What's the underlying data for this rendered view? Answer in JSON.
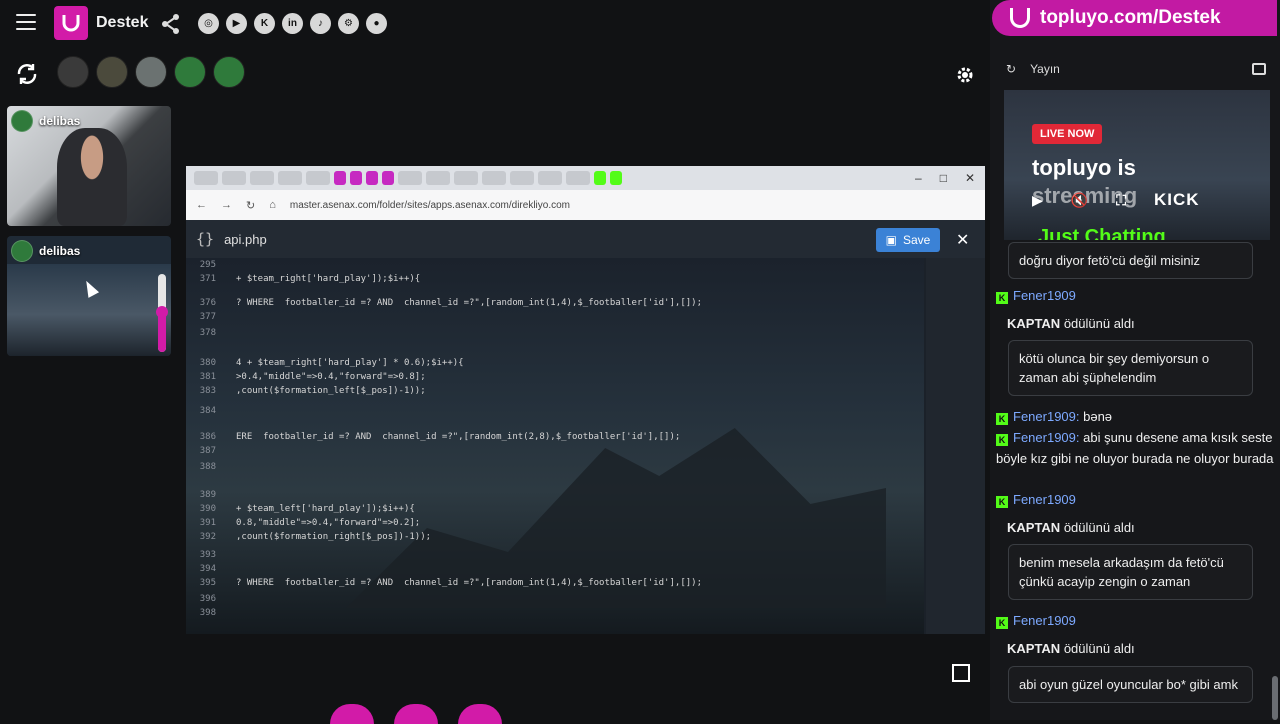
{
  "header": {
    "brand": "Destek",
    "socials": [
      "instagram-icon",
      "youtube-icon",
      "kick-icon",
      "linkedin-icon",
      "tiktok-icon",
      "steam-icon",
      "github-icon"
    ]
  },
  "cams": [
    {
      "name": "delibas"
    },
    {
      "name": "delibas"
    }
  ],
  "screen": {
    "url": "master.asenax.com/folder/sites/apps.asenax.com/direkliyo.com",
    "editor_title": "api.php",
    "save_label": "Save",
    "code_lines": [
      {
        "n": "295",
        "t": ""
      },
      {
        "n": "371",
        "t": "+ $team_right['hard_play']);$i++){"
      },
      {
        "n": "376",
        "t": "? WHERE  footballer_id =? AND  channel_id =?\",[random_int(1,4),$_footballer['id'],[]);"
      },
      {
        "n": "377",
        "t": ""
      },
      {
        "n": "378",
        "t": ""
      },
      {
        "n": "380",
        "t": "4 + $team_right['hard_play'] * 0.6);$i++){"
      },
      {
        "n": "381",
        "t": ">0.4,\"middle\"=>0.4,\"forward\"=>0.8];"
      },
      {
        "n": "383",
        "t": ",count($formation_left[$_pos])-1));"
      },
      {
        "n": "384",
        "t": ""
      },
      {
        "n": "386",
        "t": "ERE  footballer_id =? AND  channel_id =?\",[random_int(2,8),$_footballer['id'],[]);"
      },
      {
        "n": "387",
        "t": ""
      },
      {
        "n": "388",
        "t": ""
      },
      {
        "n": "389",
        "t": ""
      },
      {
        "n": "390",
        "t": "+ $team_left['hard_play']);$i++){"
      },
      {
        "n": "391",
        "t": "0.8,\"middle\"=>0.4,\"forward\"=>0.2];"
      },
      {
        "n": "392",
        "t": ",count($formation_right[$_pos])-1));"
      },
      {
        "n": "393",
        "t": ""
      },
      {
        "n": "394",
        "t": ""
      },
      {
        "n": "395",
        "t": "? WHERE  footballer_id =? AND  channel_id =?\",[random_int(1,4),$_footballer['id'],[]);"
      },
      {
        "n": "396",
        "t": ""
      },
      {
        "n": "398",
        "t": ""
      }
    ]
  },
  "panel": {
    "banner": "topluyo.com/Destek",
    "stream_label": "Yayın",
    "live_badge": "LIVE NOW",
    "streaming_line1": "topluyo is",
    "streaming_line2": "streaming",
    "category": "Just Chatting",
    "kick_label": "KICK",
    "chat": [
      {
        "type": "bubble",
        "text": "doğru diyor fetö'cü değil misiniz"
      },
      {
        "type": "user",
        "user": "Fener1909",
        "text": ""
      },
      {
        "type": "sys",
        "user": "KAPTAN",
        "text": " ödülünü aldı"
      },
      {
        "type": "bubble",
        "text": "kötü olunca bir şey demiyorsun o zaman abi şüphelendim"
      },
      {
        "type": "user",
        "user": "Fener1909:",
        "text": " bənə"
      },
      {
        "type": "user",
        "user": "Fener1909:",
        "text": " abi şunu desene ama kısık seste böyle kız gibi ne oluyor burada ne oluyor burada"
      },
      {
        "type": "user",
        "user": "Fener1909",
        "text": ""
      },
      {
        "type": "sys",
        "user": "KAPTAN",
        "text": " ödülünü aldı"
      },
      {
        "type": "bubble",
        "text": "benim mesela arkadaşım da fetö'cü çünkü acayip zengin o zaman"
      },
      {
        "type": "user",
        "user": "Fener1909",
        "text": ""
      },
      {
        "type": "sys",
        "user": "KAPTAN",
        "text": " ödülünü aldı"
      },
      {
        "type": "bubble",
        "text": "abi oyun güzel oyuncular bo* gibi amk"
      }
    ]
  }
}
